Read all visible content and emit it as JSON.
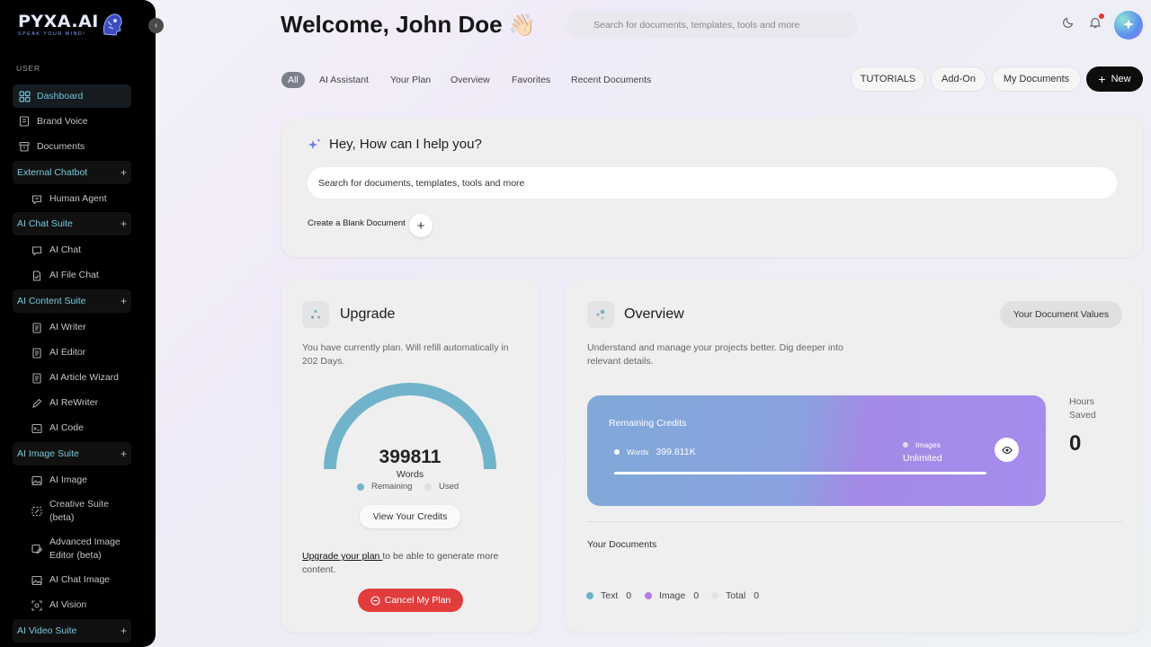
{
  "app": {
    "logo": "PYXA.AI",
    "logo_tagline": "SPEAK YOUR MIND!"
  },
  "sidebar": {
    "section_label": "USER",
    "top_items": [
      {
        "label": "Dashboard",
        "icon": "grid-icon",
        "active": true
      },
      {
        "label": "Brand Voice",
        "icon": "book-icon"
      },
      {
        "label": "Documents",
        "icon": "archive-icon"
      }
    ],
    "groups": [
      {
        "label": "External Chatbot",
        "items": [
          {
            "label": "Human Agent",
            "icon": "chat-icon"
          }
        ]
      },
      {
        "label": "AI Chat Suite",
        "items": [
          {
            "label": "AI Chat",
            "icon": "chat-icon"
          },
          {
            "label": "AI File Chat",
            "icon": "file-icon"
          }
        ]
      },
      {
        "label": "AI Content Suite",
        "items": [
          {
            "label": "AI Writer",
            "icon": "doc-icon"
          },
          {
            "label": "AI Editor",
            "icon": "doc-icon"
          },
          {
            "label": "AI Article Wizard",
            "icon": "doc-icon"
          },
          {
            "label": "AI ReWriter",
            "icon": "pen-icon"
          },
          {
            "label": "AI Code",
            "icon": "terminal-icon"
          }
        ]
      },
      {
        "label": "AI Image Suite",
        "items": [
          {
            "label": "AI Image",
            "icon": "image-icon"
          },
          {
            "label": "Creative Suite (beta)",
            "icon": "magic-icon"
          },
          {
            "label": "Advanced Image Editor (beta)",
            "icon": "image-edit-icon"
          },
          {
            "label": "AI Chat Image",
            "icon": "image-icon"
          },
          {
            "label": "AI Vision",
            "icon": "vision-icon"
          }
        ]
      },
      {
        "label": "AI Video Suite",
        "items": []
      }
    ],
    "plus": "+"
  },
  "header": {
    "welcome": "Welcome, John Doe",
    "wave": "👋🏻",
    "search_placeholder": "Search for documents, templates, tools and more"
  },
  "tabs": [
    "All",
    "AI Assistant",
    "Your Plan",
    "Overview",
    "Favorites",
    "Recent Documents"
  ],
  "actions": {
    "tutorials": "TUTORIALS",
    "addon": "Add-On",
    "my_documents": "My Documents",
    "new": "New"
  },
  "help": {
    "title": "Hey, How can I help you?",
    "search_value": "Search for documents, templates, tools and more",
    "blank_doc": "Create a Blank Document"
  },
  "upgrade": {
    "title": "Upgrade",
    "description": "You have currently plan. Will refill automatically in 202 Days.",
    "gauge_value": "399811",
    "gauge_unit": "Words",
    "remaining_fraction": 1.0,
    "legend_remaining": "Remaining",
    "legend_used": "Used",
    "view_credits": "View Your Credits",
    "upgrade_link": "Upgrade your plan ",
    "upgrade_text": "to be able to generate more content.",
    "cancel": "Cancel My Plan"
  },
  "overview": {
    "title": "Overview",
    "doc_values": "Your Document Values",
    "description": "Understand and manage your projects better. Dig deeper into relevant details.",
    "credits_title": "Remaining Credits",
    "words_label": "Words",
    "words_value": "399.811K",
    "images_label": "Images",
    "images_value": "Unlimited",
    "words_progress": 1.0,
    "hours_label": "Hours Saved",
    "hours_value": "0",
    "your_documents": "Your Documents",
    "doc_stats": [
      {
        "label": "Text",
        "value": "0",
        "color": "#6fb1c9"
      },
      {
        "label": "Image",
        "value": "0",
        "color": "#b27ee8"
      },
      {
        "label": "Total",
        "value": "0",
        "color": "#e2e2e2"
      }
    ]
  },
  "colors": {
    "accent": "#6cc3d8",
    "gauge": "#72b3cc",
    "danger": "#e23d3d"
  }
}
